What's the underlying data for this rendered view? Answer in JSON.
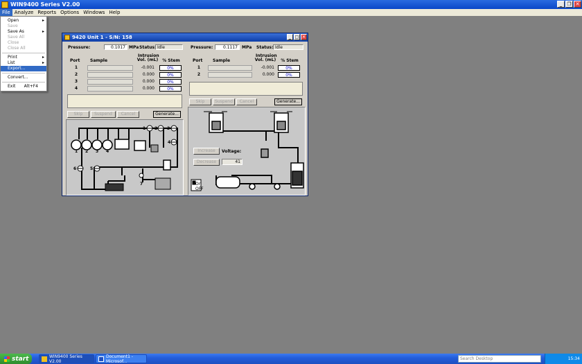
{
  "app": {
    "title": "WIN9400 Series V2.00",
    "menu": [
      "File",
      "Analyze",
      "Reports",
      "Options",
      "Windows",
      "Help"
    ]
  },
  "file_menu": {
    "items": [
      {
        "label": "Open",
        "disabled": false,
        "submenu": true
      },
      {
        "label": "Save",
        "disabled": true
      },
      {
        "label": "Save As",
        "disabled": false,
        "submenu": true
      },
      {
        "label": "Save All",
        "disabled": true
      },
      {
        "label": "Close",
        "disabled": true
      },
      {
        "label": "Close All",
        "disabled": true
      },
      {
        "sep": true
      },
      {
        "label": "Print",
        "disabled": false,
        "submenu": true
      },
      {
        "label": "List",
        "disabled": false,
        "submenu": true
      },
      {
        "label": "Export...",
        "disabled": false,
        "highlighted": true
      },
      {
        "sep": true
      },
      {
        "label": "Convert...",
        "disabled": false
      },
      {
        "sep": true
      },
      {
        "label": "Exit",
        "shortcut": "Alt+F4",
        "disabled": false
      }
    ]
  },
  "unit_window": {
    "title": "9420 Unit 1 - S/N: 158",
    "left": {
      "pressure_label": "Pressure:",
      "pressure_value": "0.1017",
      "pressure_unit": "MPa",
      "status_label": "Status:",
      "status_value": "Idle",
      "headers": {
        "port": "Port",
        "sample": "Sample",
        "intrusion": "Intrusion",
        "vol": "Vol. (mL)",
        "stem": "% Stem"
      },
      "rows": [
        {
          "port": "1",
          "vol": "-0.001",
          "pct": "0%"
        },
        {
          "port": "2",
          "vol": "0.000",
          "pct": "0%"
        },
        {
          "port": "3",
          "vol": "0.000",
          "pct": "0%"
        },
        {
          "port": "4",
          "vol": "0.000",
          "pct": "0%"
        }
      ],
      "buttons": {
        "skip": "Skip",
        "suspend": "Suspend",
        "cancel": "Cancel",
        "generate": "Generate..."
      },
      "schematic_labels": {
        "v1": "1",
        "v2": "2",
        "v3": "3",
        "v4": "4",
        "v5": "5",
        "v6": "6",
        "v7": "7",
        "p1": "1",
        "p2": "2",
        "p3": "3",
        "p4": "4"
      }
    },
    "right": {
      "pressure_label": "Pressure:",
      "pressure_value": "0.1117",
      "pressure_unit": "MPa",
      "status_label": "Status:",
      "status_value": "Idle",
      "headers": {
        "port": "Port",
        "sample": "Sample",
        "intrusion": "Intrusion",
        "vol": "Vol. (mL)",
        "stem": "% Stem"
      },
      "rows": [
        {
          "port": "1",
          "vol": "-0.001",
          "pct": "0%"
        },
        {
          "port": "2",
          "vol": "0.000",
          "pct": "0%"
        }
      ],
      "buttons": {
        "skip": "Skip",
        "suspend": "Suspend",
        "cancel": "Cancel",
        "generate": "Generate..."
      },
      "increase": "Increase",
      "decrease": "Decrease",
      "voltage_label": "Voltage:",
      "voltage_value": "41",
      "on": "On",
      "off": "OFF"
    }
  },
  "taskbar": {
    "start": "start",
    "tasks": [
      {
        "label": "WIN9400 Series V2.00",
        "active": true
      },
      {
        "label": "Document1 - Microsof...",
        "active": false
      }
    ],
    "search_placeholder": "Search Desktop",
    "clock": "15:34"
  }
}
